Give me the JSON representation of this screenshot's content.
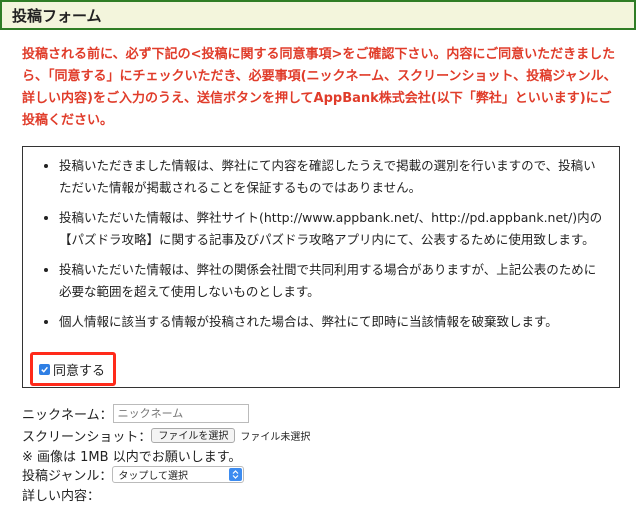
{
  "header": {
    "title": "投稿フォーム"
  },
  "notice": {
    "text": "投稿される前に、必ず下記の<投稿に関する同意事項>をご確認下さい。内容にご同意いただきましたら、「同意する」にチェックいただき、必要事項(ニックネーム、スクリーンショット、投稿ジャンル、詳しい内容)をご入力のうえ、送信ボタンを押してAppBank株式会社(以下「弊社」といいます)にご投稿ください。"
  },
  "terms": {
    "items": [
      "投稿いただきました情報は、弊社にて内容を確認したうえで掲載の選別を行いますので、投稿いただいた情報が掲載されることを保証するものではありません。",
      "投稿いただいた情報は、弊社サイト(http://www.appbank.net/、http://pd.appbank.net/)内の【パズドラ攻略】に関する記事及びパズドラ攻略アプリ内にて、公表するために使用致します。",
      "投稿いただいた情報は、弊社の関係会社間で共同利用する場合がありますが、上記公表のために必要な範囲を超えて使用しないものとします。",
      "個人情報に該当する情報が投稿された場合は、弊社にて即時に当該情報を破棄致します。"
    ],
    "agree_label": "同意する",
    "agree_checked": true
  },
  "form": {
    "nickname_label": "ニックネーム：",
    "nickname_placeholder": "ニックネーム",
    "screenshot_label": "スクリーンショット：",
    "file_button": "ファイルを選択",
    "file_status": "ファイル未選択",
    "image_note": "※ 画像は 1MB 以内でお願いします。",
    "genre_label": "投稿ジャンル：",
    "genre_selected": "タップして選択",
    "details_label": "詳しい内容："
  },
  "colors": {
    "header_border": "#2f7d25",
    "header_bg": "#f3f5dc",
    "notice": "#e03c2a",
    "highlight": "#ff2a1a",
    "checkbox": "#2f7fe4"
  }
}
